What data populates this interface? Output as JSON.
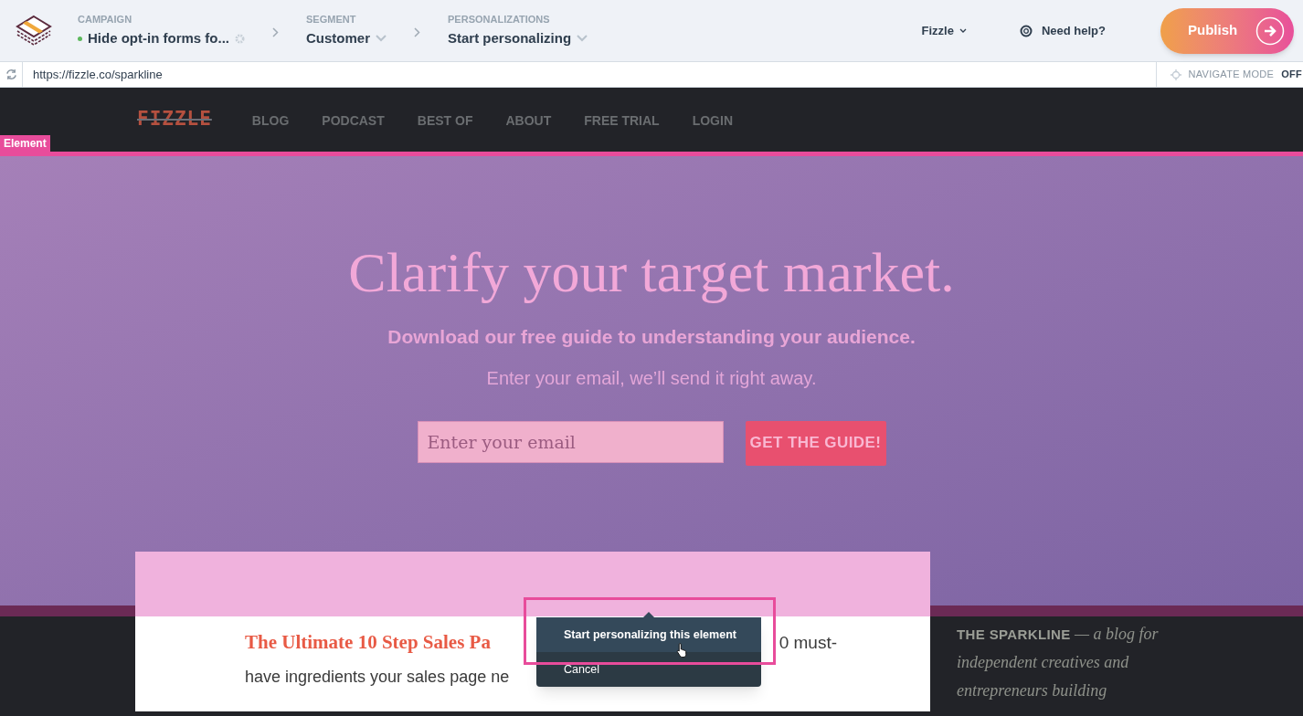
{
  "app_bar": {
    "breadcrumbs": [
      {
        "kind": "campaign",
        "label": "CAMPAIGN",
        "value": "Hide opt-in forms fo..."
      },
      {
        "kind": "dropdown",
        "label": "SEGMENT",
        "value": "Customer"
      },
      {
        "kind": "dropdown",
        "label": "PERSONALIZATIONS",
        "value": "Start personalizing"
      }
    ],
    "account": "Fizzle",
    "help": "Need help?",
    "publish": "Publish"
  },
  "url_bar": {
    "url": "https://fizzle.co/sparkline",
    "mode_label": "NAVIGATE MODE",
    "mode_value": "OFF"
  },
  "site": {
    "logo": "FIZZLE",
    "nav": [
      "BLOG",
      "PODCAST",
      "BEST OF",
      "ABOUT",
      "FREE TRIAL",
      "LOGIN"
    ],
    "hero": {
      "title": "Clarify your target market.",
      "subtitle": "Download our free guide to understanding your audience.",
      "note": "Enter your email, we’ll send it right away.",
      "email_placeholder": "Enter your email",
      "button": "GET THE GUIDE!"
    },
    "article": {
      "headline": "The Ultimate 10 Step Sales Pa",
      "line_1_end": "0 must-",
      "line_2": "have ingredients your sales page ne"
    },
    "sidebar": {
      "text": "**THE SPARKLINE** *— a blog for independent creatives and entrepreneurs building*"
    }
  },
  "overlay": {
    "element_label": "Element",
    "menu": [
      {
        "label": "Start personalizing this element",
        "selected": true
      },
      {
        "label": "Cancel",
        "selected": false
      }
    ]
  }
}
